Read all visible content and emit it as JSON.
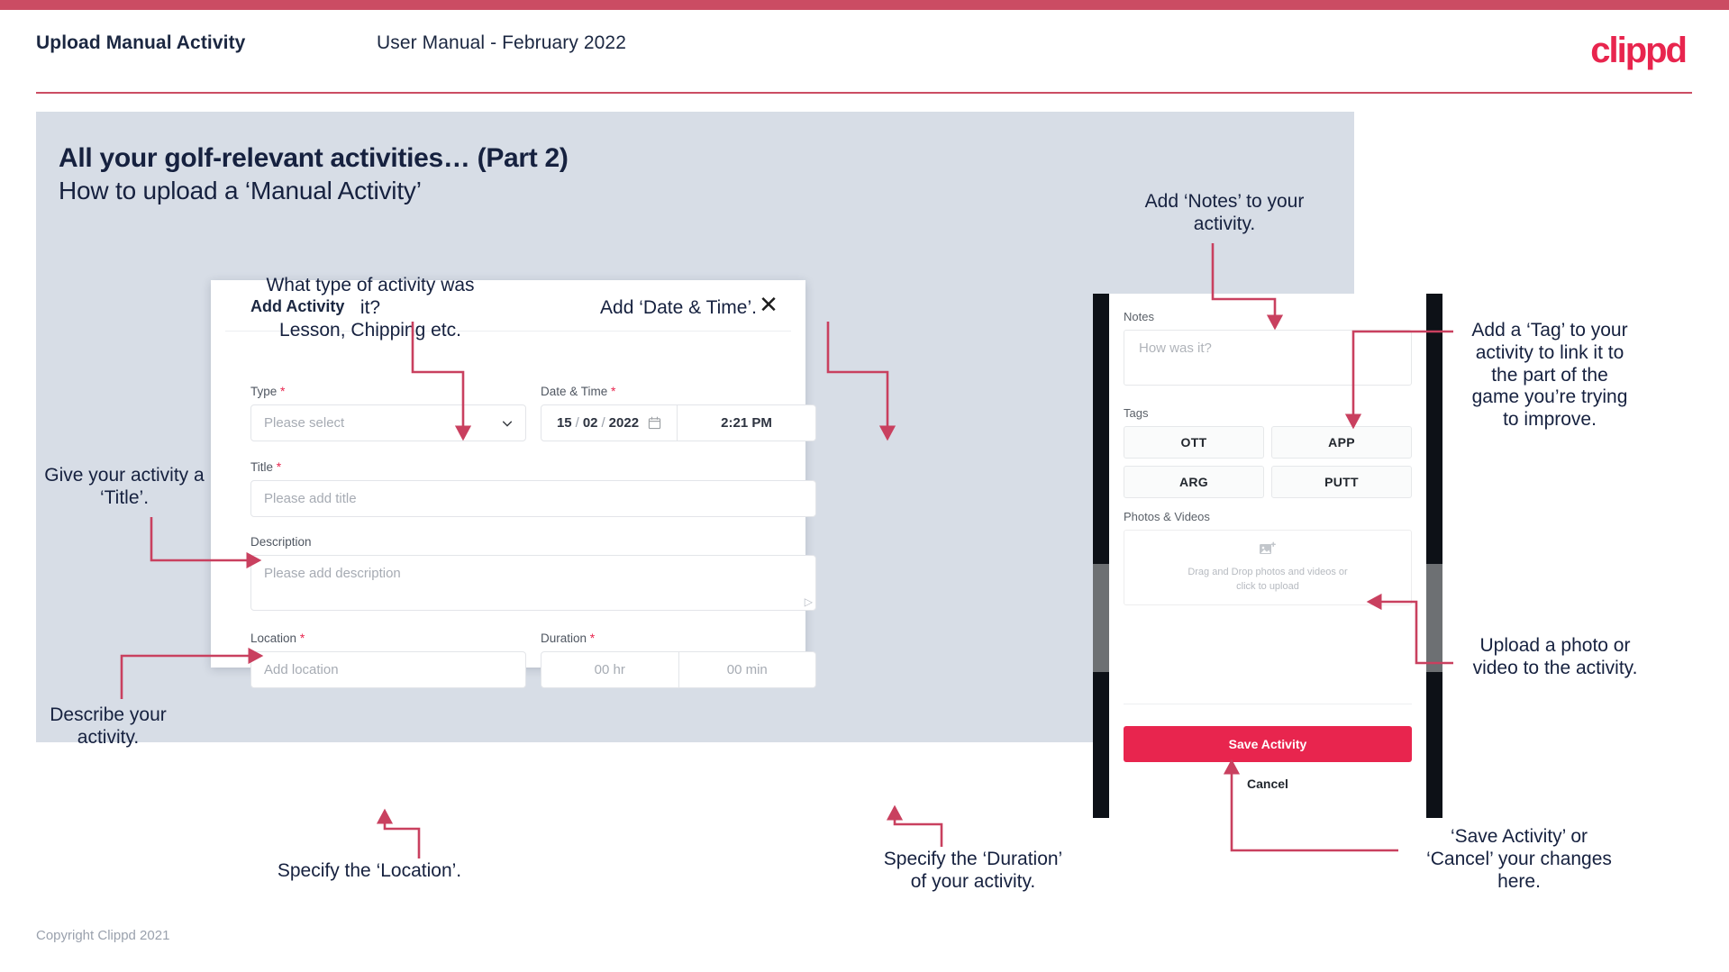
{
  "header": {
    "title": "Upload Manual Activity",
    "subtitle": "User Manual - February 2022",
    "logo": "clippd"
  },
  "slide": {
    "title": "All your golf-relevant activities… (Part 2)",
    "subtitle": "How to upload a ‘Manual Activity’"
  },
  "footer": {
    "copyright": "Copyright Clippd 2021"
  },
  "dialog": {
    "title": "Add Activity",
    "close_icon": "close-icon",
    "fields": {
      "type": {
        "label": "Type",
        "required": "*",
        "placeholder": "Please select"
      },
      "datetime": {
        "label": "Date & Time",
        "required": "*",
        "day": "15",
        "month": "02",
        "year": "2022",
        "sep": "/",
        "time": "2:21 PM"
      },
      "title": {
        "label": "Title",
        "required": "*",
        "placeholder": "Please add title"
      },
      "description": {
        "label": "Description",
        "placeholder": "Please add description"
      },
      "location": {
        "label": "Location",
        "required": "*",
        "placeholder": "Add location"
      },
      "duration": {
        "label": "Duration",
        "required": "*",
        "hours": "00 hr",
        "minutes": "00 min"
      }
    }
  },
  "phone": {
    "notes": {
      "label": "Notes",
      "placeholder": "How was it?"
    },
    "tags": {
      "label": "Tags",
      "items": [
        "OTT",
        "APP",
        "ARG",
        "PUTT"
      ]
    },
    "photos": {
      "label": "Photos & Videos",
      "drop_line1": "Drag and Drop photos and videos or",
      "drop_line2": "click to upload"
    },
    "save_label": "Save Activity",
    "cancel_label": "Cancel"
  },
  "annotations": {
    "type": "What type of activity was it?\nLesson, Chipping etc.",
    "datetime": "Add ‘Date & Time’.",
    "title": "Give your activity a\n‘Title’.",
    "description": "Describe your\nactivity.",
    "location": "Specify the ‘Location’.",
    "duration": "Specify the ‘Duration’\nof your activity.",
    "notes": "Add ‘Notes’ to your\nactivity.",
    "tags": "Add a ‘Tag’ to your\nactivity to link it to\nthe part of the\ngame you’re trying\nto improve.",
    "upload": "Upload a photo or\nvideo to the activity.",
    "save": "‘Save Activity’ or\n‘Cancel’ your changes\nhere."
  },
  "colors": {
    "brand_red": "#e8254e",
    "bar_red": "#cb4c63",
    "arrow_red": "#c9405f",
    "slide_bg": "#d7dde6",
    "navy": "#16213f"
  }
}
